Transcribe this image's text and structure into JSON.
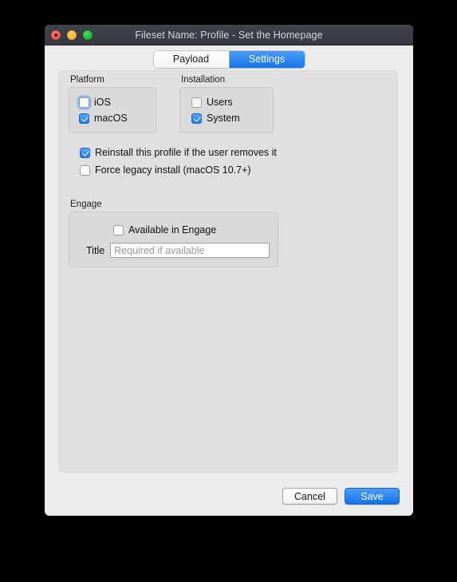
{
  "window": {
    "title": "Fileset Name: Profile - Set the Homepage",
    "traffic_lights": [
      {
        "name": "close",
        "color": "#ef5148"
      },
      {
        "name": "minimize",
        "color": "#f7b233"
      },
      {
        "name": "zoom",
        "color": "#1fb92f"
      }
    ]
  },
  "tabs": [
    {
      "label": "Payload",
      "active": false
    },
    {
      "label": "Settings",
      "active": true
    }
  ],
  "groups": {
    "platform": {
      "label": "Platform",
      "items": [
        {
          "label": "iOS",
          "checked": false,
          "focused": true
        },
        {
          "label": "macOS",
          "checked": true,
          "focused": false
        }
      ]
    },
    "installation": {
      "label": "Installation",
      "items": [
        {
          "label": "Users",
          "checked": false,
          "focused": false
        },
        {
          "label": "System",
          "checked": true,
          "focused": false
        }
      ]
    },
    "engage": {
      "label": "Engage",
      "available_checkbox": {
        "label": "Available in Engage",
        "checked": false
      },
      "title_field": {
        "label": "Title",
        "value": "",
        "placeholder": "Required if available"
      }
    }
  },
  "options": [
    {
      "label": "Reinstall this profile if the user removes it",
      "checked": true
    },
    {
      "label": "Force legacy install (macOS 10.7+)",
      "checked": false
    }
  ],
  "buttons": {
    "cancel": "Cancel",
    "save": "Save"
  },
  "colors": {
    "accent": "#1473e8",
    "titlebar": "#3a3d43",
    "window_bg": "#ececec",
    "panel_bg": "#e0e0e0",
    "group_bg": "#dadada"
  }
}
